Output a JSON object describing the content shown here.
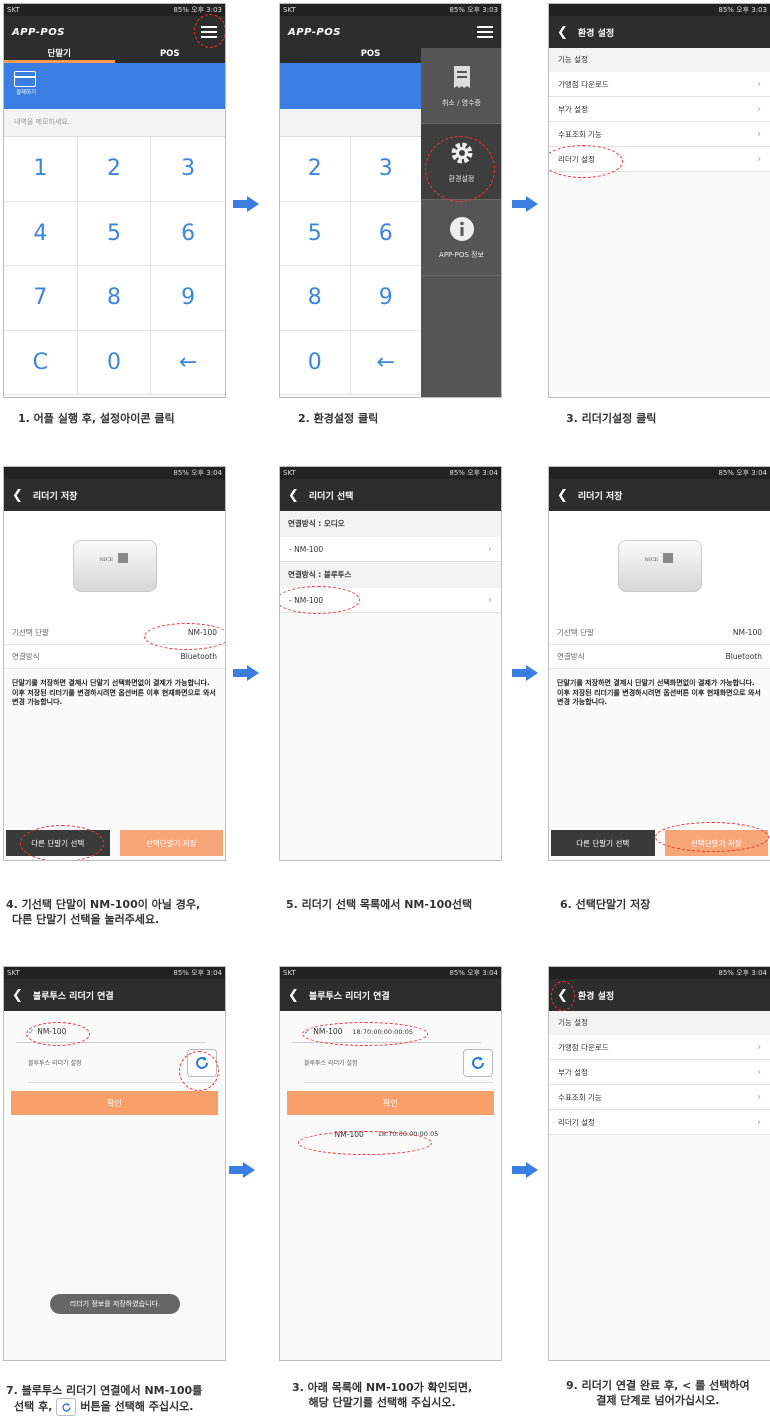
{
  "status": {
    "carrier": "SKT",
    "battery": "85%",
    "time_a": "오후 3:03",
    "time_b": "오후 3:04",
    "lte": "LTE"
  },
  "s1": {
    "logo": "APP-POS",
    "tab1": "단말기",
    "tab2": "POS",
    "card_label": "결제하기",
    "memo": "내역을 메모하세요.",
    "keys": [
      "1",
      "2",
      "3",
      "4",
      "5",
      "6",
      "7",
      "8",
      "9",
      "C",
      "0",
      "←"
    ]
  },
  "s2": {
    "tab": "POS",
    "cancel": "취소 / 영수증",
    "settings": "환경설정",
    "info": "APP-POS 정보",
    "keys": [
      "2",
      "3",
      "5",
      "6",
      "8",
      "9",
      "0",
      "←"
    ]
  },
  "s3": {
    "title": "환경 설정",
    "section": "기능 설정",
    "items": [
      "가맹점 다운로드",
      "부가 설정",
      "수표조회 기능",
      "리더기 설정"
    ]
  },
  "s4": {
    "title": "리더기 저장",
    "device_brand": "NICE",
    "selected_label": "기선택 단말",
    "selected_value": "NM-100",
    "conn_label": "연결방식",
    "conn_value": "Bluetooth",
    "desc": "단말기를 저장하면 결제시 단말기 선택화면없이 결제가 가능합니다. 이후 저장된 리더기를 변경하시려면 옵션버튼 이후 현재화면으로 와서 변경 가능합니다.",
    "btn_other": "다른 단말기 선택",
    "btn_save": "선택단말기 저장"
  },
  "s5": {
    "title": "리더기 선택",
    "sec_audio": "연결방식 : 오디오",
    "audio_item": "- NM-100",
    "sec_bt": "연결방식 : 블루투스",
    "bt_item": "- NM-100"
  },
  "s7": {
    "title": "블루투스 리더기 연결",
    "device": "NM-100",
    "setting": "블루투스 리더기 설정",
    "ok": "확인",
    "toast": "리더기 정보를 저장하였습니다."
  },
  "s8": {
    "title": "블루투스 리더기 연결",
    "device": "NM-100",
    "mac": "18:70:00:00:00:05",
    "setting": "블루투스 리더기 설정",
    "ok": "확인"
  },
  "captions": {
    "c1": "1. 어플 실행 후, 설정아이콘 클릭",
    "c2": "2. 환경설정 클릭",
    "c3": "3. 리더기설정 클릭",
    "c4a": "4. 기선택 단말이 NM-100이 아닐 경우,",
    "c4b": "다른 단말기 선택을 눌러주세요.",
    "c5": "5. 리더기 선택 목록에서 NM-100선택",
    "c6": "6. 선택단말기 저장",
    "c7a": "7. 블루투스 리더기 연결에서 NM-100를",
    "c7b": "선택 후,",
    "c7c": "버튼을 선택해 주십시오.",
    "c8a": "3. 아래 목록에 NM-100가 확인되면,",
    "c8b": "해당 단말기를 선택해 주십시오.",
    "c9a": "9. 리더기 연결 완료 후, < 를 선택하여",
    "c9b": "결제 단계로 넘어가십시오."
  },
  "colors": {
    "accent": "#3b7ee2",
    "orange": "#f7a06a",
    "highlight": "#e33333"
  }
}
